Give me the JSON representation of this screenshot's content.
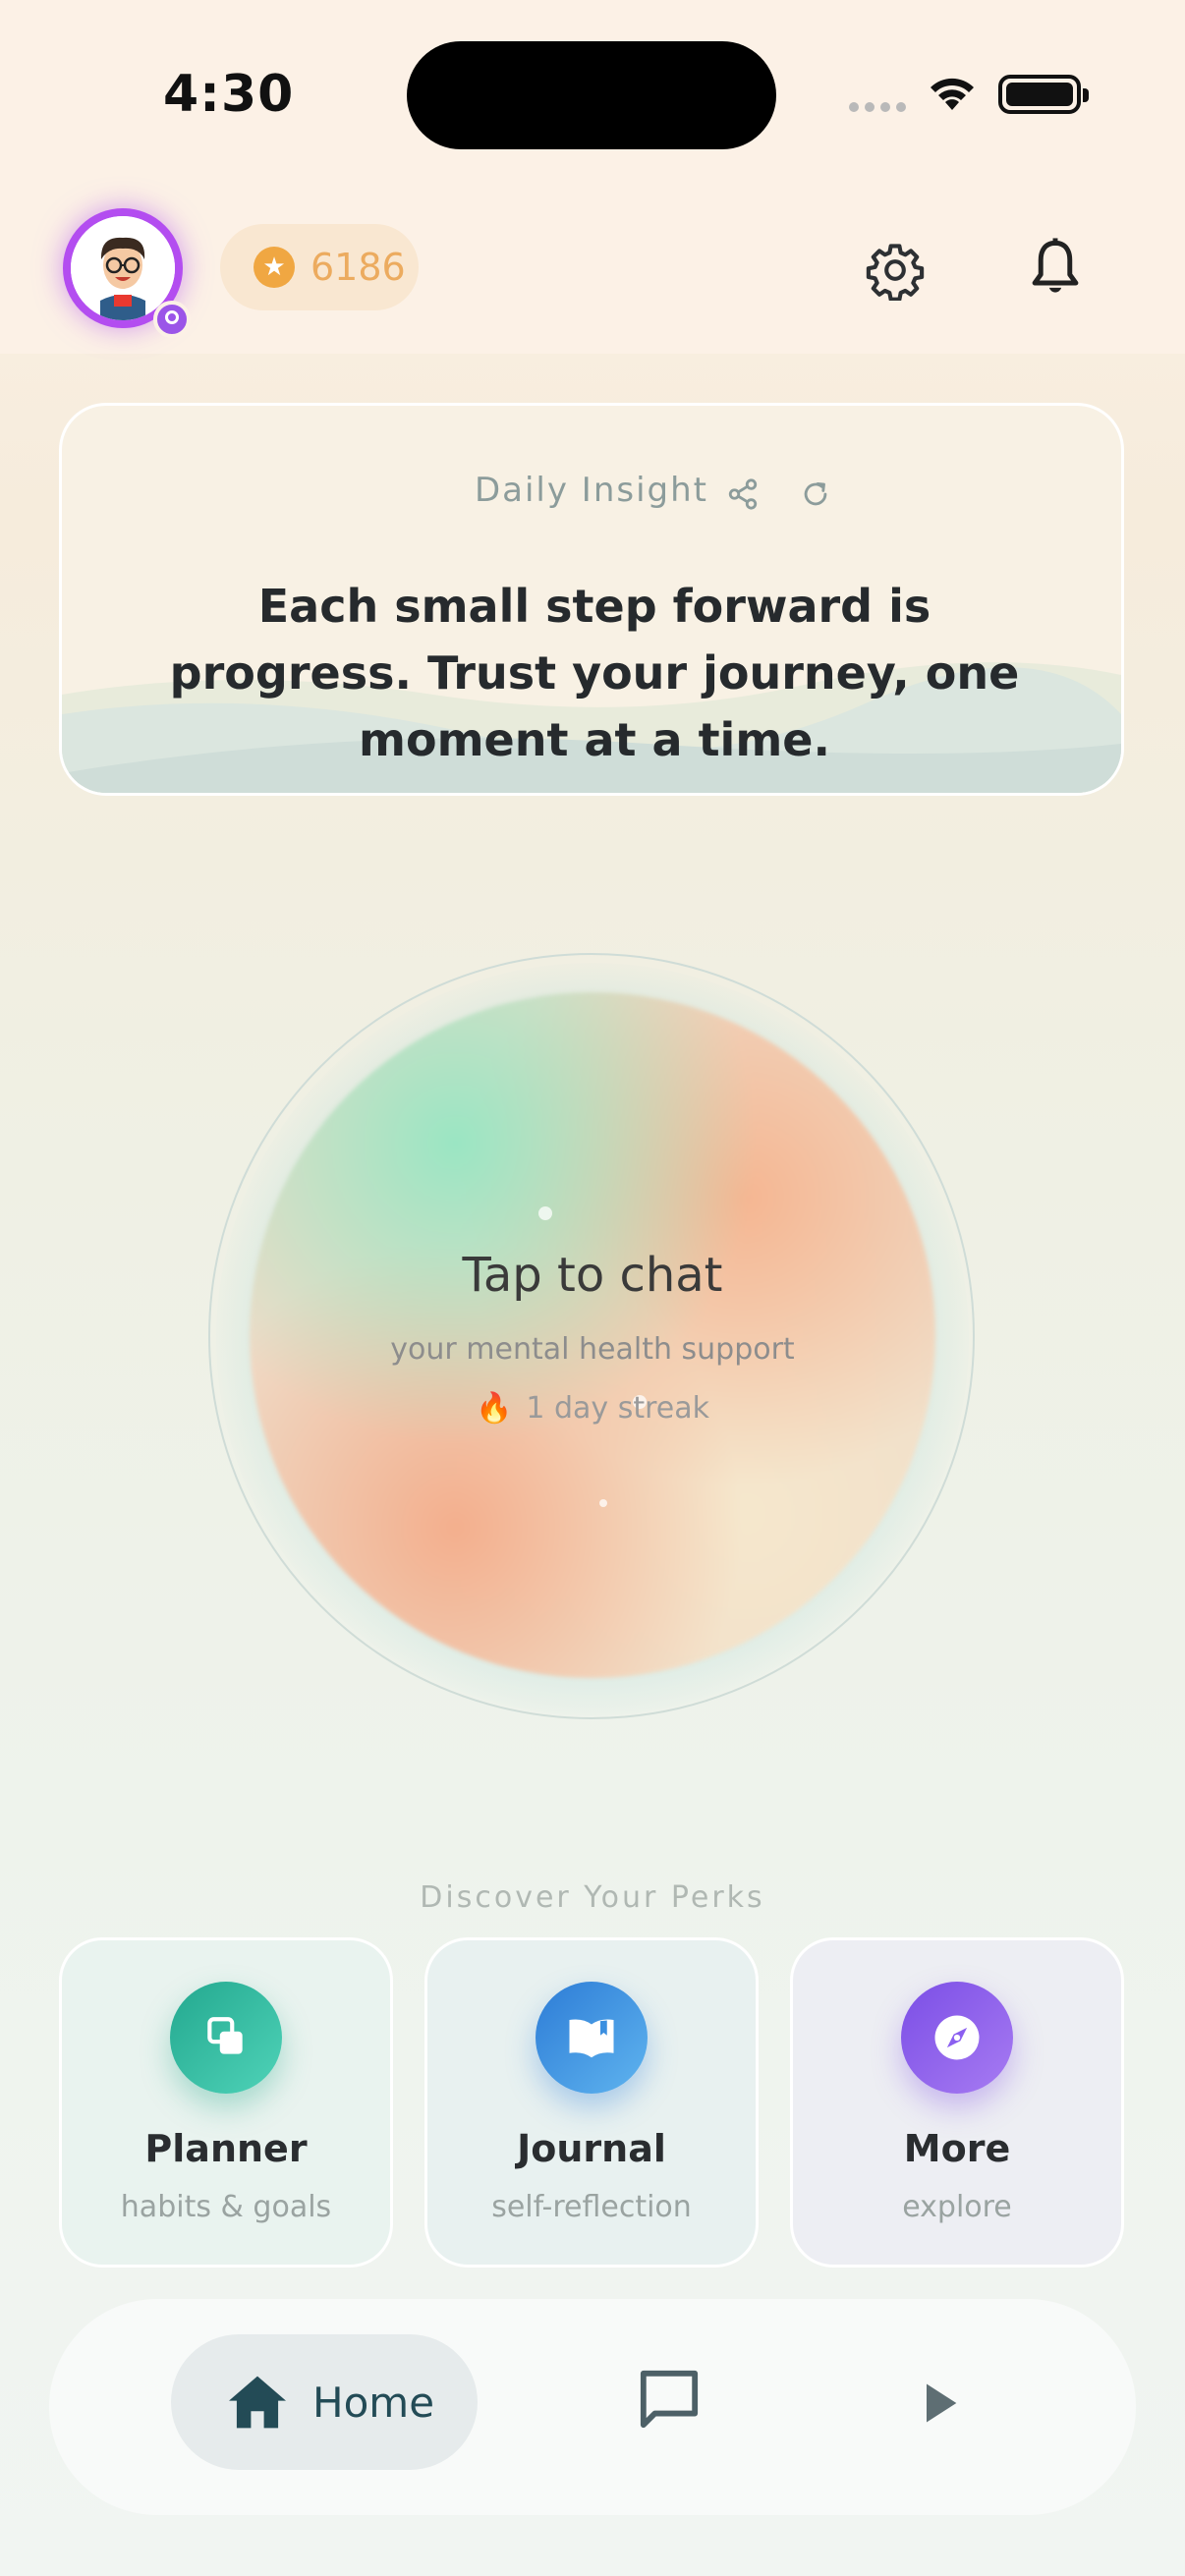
{
  "status_bar": {
    "time": "4:30"
  },
  "header": {
    "points": "6186",
    "icons": [
      "avatar",
      "star-coin-icon",
      "gear-icon",
      "bell-icon"
    ]
  },
  "insight": {
    "title": "Daily Insight",
    "quote": "Each small step forward is progress. Trust your journey, one moment at a time.",
    "icons": [
      "share-icon",
      "refresh-icon"
    ]
  },
  "orb": {
    "title": "Tap to chat",
    "subtitle": "your mental health support",
    "streak": "1 day streak"
  },
  "perks": {
    "heading": "Discover Your Perks",
    "items": [
      {
        "label": "Planner",
        "sub": "habits & goals",
        "icon": "copy-icon",
        "color": "#2bb79a"
      },
      {
        "label": "Journal",
        "sub": "self-reflection",
        "icon": "open-book-icon",
        "color": "#3b8fe0"
      },
      {
        "label": "More",
        "sub": "explore",
        "icon": "compass-icon",
        "color": "#8b5ff0"
      }
    ]
  },
  "nav": {
    "home_label": "Home",
    "items": [
      "home-icon",
      "chat-icon",
      "play-icon"
    ],
    "active": "Home"
  },
  "colors": {
    "accent_purple": "#b34df0",
    "points_orange": "#ecab5f",
    "nav_home": "#234b56"
  }
}
